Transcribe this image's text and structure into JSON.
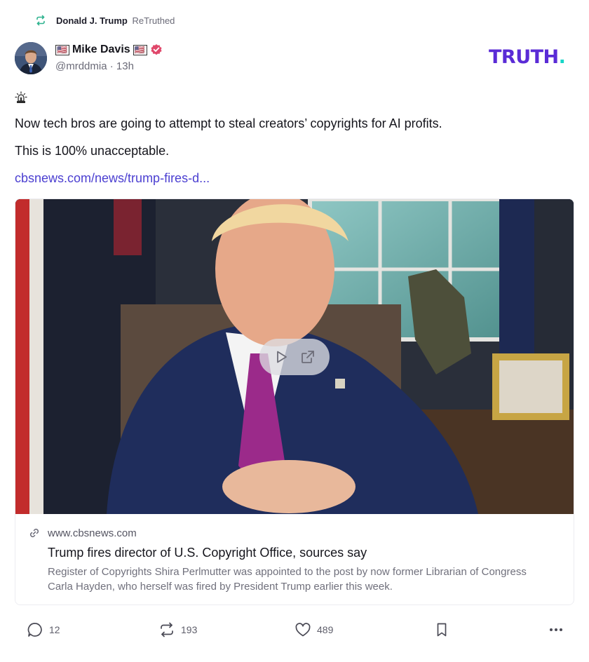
{
  "retruth": {
    "name": "Donald J. Trump",
    "verb": "ReTruthed",
    "icon": "retruth-icon"
  },
  "author": {
    "flag_left": "🇺🇸",
    "display_name": "Mike Davis",
    "flag_right": "🇺🇸",
    "handle": "@mrddmia",
    "time": "· 13h",
    "verified": true
  },
  "brand": {
    "text": "TRUTH",
    "dot": ".",
    "colors": {
      "text": "#5a2bd6",
      "dot": "#16d6c8"
    }
  },
  "post": {
    "emoji": "alarm-emoji",
    "line1": "Now tech bros are going to attempt to steal creators’ copyrights for AI profits.",
    "line2": "This is 100% unacceptable.",
    "link": "cbsnews.com/news/trump-fires-d..."
  },
  "card": {
    "domain": "www.cbsnews.com",
    "title": "Trump fires director of U.S. Copyright Office, sources say",
    "description": "Register of Copyrights Shira Perlmutter was appointed to the post by now former Librarian of Congress Carla Hayden, who herself was fired by President Trump earlier this week."
  },
  "actions": {
    "replies": "12",
    "retruths": "193",
    "likes": "489"
  },
  "colors": {
    "accent": "#4b3fd1",
    "muted": "#6b6b78",
    "verified": "#e0486b"
  }
}
